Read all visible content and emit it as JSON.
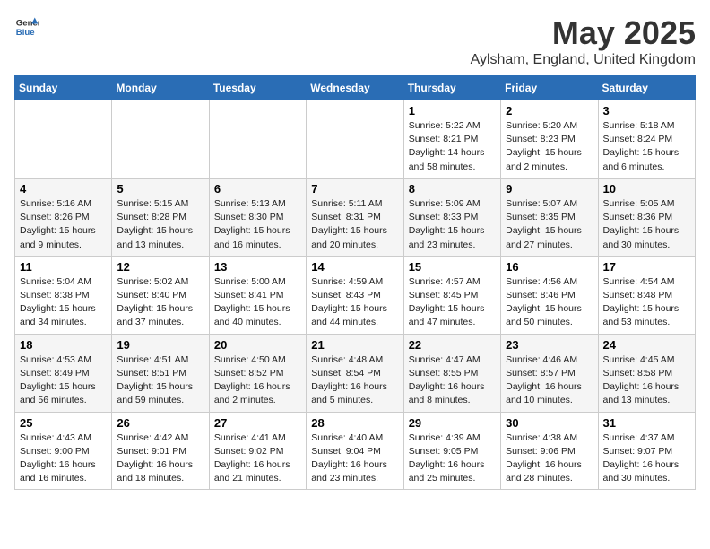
{
  "header": {
    "logo_general": "General",
    "logo_blue": "Blue",
    "title": "May 2025",
    "subtitle": "Aylsham, England, United Kingdom"
  },
  "weekdays": [
    "Sunday",
    "Monday",
    "Tuesday",
    "Wednesday",
    "Thursday",
    "Friday",
    "Saturday"
  ],
  "weeks": [
    [
      {
        "day": "",
        "info": ""
      },
      {
        "day": "",
        "info": ""
      },
      {
        "day": "",
        "info": ""
      },
      {
        "day": "",
        "info": ""
      },
      {
        "day": "1",
        "info": "Sunrise: 5:22 AM\nSunset: 8:21 PM\nDaylight: 14 hours\nand 58 minutes."
      },
      {
        "day": "2",
        "info": "Sunrise: 5:20 AM\nSunset: 8:23 PM\nDaylight: 15 hours\nand 2 minutes."
      },
      {
        "day": "3",
        "info": "Sunrise: 5:18 AM\nSunset: 8:24 PM\nDaylight: 15 hours\nand 6 minutes."
      }
    ],
    [
      {
        "day": "4",
        "info": "Sunrise: 5:16 AM\nSunset: 8:26 PM\nDaylight: 15 hours\nand 9 minutes."
      },
      {
        "day": "5",
        "info": "Sunrise: 5:15 AM\nSunset: 8:28 PM\nDaylight: 15 hours\nand 13 minutes."
      },
      {
        "day": "6",
        "info": "Sunrise: 5:13 AM\nSunset: 8:30 PM\nDaylight: 15 hours\nand 16 minutes."
      },
      {
        "day": "7",
        "info": "Sunrise: 5:11 AM\nSunset: 8:31 PM\nDaylight: 15 hours\nand 20 minutes."
      },
      {
        "day": "8",
        "info": "Sunrise: 5:09 AM\nSunset: 8:33 PM\nDaylight: 15 hours\nand 23 minutes."
      },
      {
        "day": "9",
        "info": "Sunrise: 5:07 AM\nSunset: 8:35 PM\nDaylight: 15 hours\nand 27 minutes."
      },
      {
        "day": "10",
        "info": "Sunrise: 5:05 AM\nSunset: 8:36 PM\nDaylight: 15 hours\nand 30 minutes."
      }
    ],
    [
      {
        "day": "11",
        "info": "Sunrise: 5:04 AM\nSunset: 8:38 PM\nDaylight: 15 hours\nand 34 minutes."
      },
      {
        "day": "12",
        "info": "Sunrise: 5:02 AM\nSunset: 8:40 PM\nDaylight: 15 hours\nand 37 minutes."
      },
      {
        "day": "13",
        "info": "Sunrise: 5:00 AM\nSunset: 8:41 PM\nDaylight: 15 hours\nand 40 minutes."
      },
      {
        "day": "14",
        "info": "Sunrise: 4:59 AM\nSunset: 8:43 PM\nDaylight: 15 hours\nand 44 minutes."
      },
      {
        "day": "15",
        "info": "Sunrise: 4:57 AM\nSunset: 8:45 PM\nDaylight: 15 hours\nand 47 minutes."
      },
      {
        "day": "16",
        "info": "Sunrise: 4:56 AM\nSunset: 8:46 PM\nDaylight: 15 hours\nand 50 minutes."
      },
      {
        "day": "17",
        "info": "Sunrise: 4:54 AM\nSunset: 8:48 PM\nDaylight: 15 hours\nand 53 minutes."
      }
    ],
    [
      {
        "day": "18",
        "info": "Sunrise: 4:53 AM\nSunset: 8:49 PM\nDaylight: 15 hours\nand 56 minutes."
      },
      {
        "day": "19",
        "info": "Sunrise: 4:51 AM\nSunset: 8:51 PM\nDaylight: 15 hours\nand 59 minutes."
      },
      {
        "day": "20",
        "info": "Sunrise: 4:50 AM\nSunset: 8:52 PM\nDaylight: 16 hours\nand 2 minutes."
      },
      {
        "day": "21",
        "info": "Sunrise: 4:48 AM\nSunset: 8:54 PM\nDaylight: 16 hours\nand 5 minutes."
      },
      {
        "day": "22",
        "info": "Sunrise: 4:47 AM\nSunset: 8:55 PM\nDaylight: 16 hours\nand 8 minutes."
      },
      {
        "day": "23",
        "info": "Sunrise: 4:46 AM\nSunset: 8:57 PM\nDaylight: 16 hours\nand 10 minutes."
      },
      {
        "day": "24",
        "info": "Sunrise: 4:45 AM\nSunset: 8:58 PM\nDaylight: 16 hours\nand 13 minutes."
      }
    ],
    [
      {
        "day": "25",
        "info": "Sunrise: 4:43 AM\nSunset: 9:00 PM\nDaylight: 16 hours\nand 16 minutes."
      },
      {
        "day": "26",
        "info": "Sunrise: 4:42 AM\nSunset: 9:01 PM\nDaylight: 16 hours\nand 18 minutes."
      },
      {
        "day": "27",
        "info": "Sunrise: 4:41 AM\nSunset: 9:02 PM\nDaylight: 16 hours\nand 21 minutes."
      },
      {
        "day": "28",
        "info": "Sunrise: 4:40 AM\nSunset: 9:04 PM\nDaylight: 16 hours\nand 23 minutes."
      },
      {
        "day": "29",
        "info": "Sunrise: 4:39 AM\nSunset: 9:05 PM\nDaylight: 16 hours\nand 25 minutes."
      },
      {
        "day": "30",
        "info": "Sunrise: 4:38 AM\nSunset: 9:06 PM\nDaylight: 16 hours\nand 28 minutes."
      },
      {
        "day": "31",
        "info": "Sunrise: 4:37 AM\nSunset: 9:07 PM\nDaylight: 16 hours\nand 30 minutes."
      }
    ]
  ]
}
